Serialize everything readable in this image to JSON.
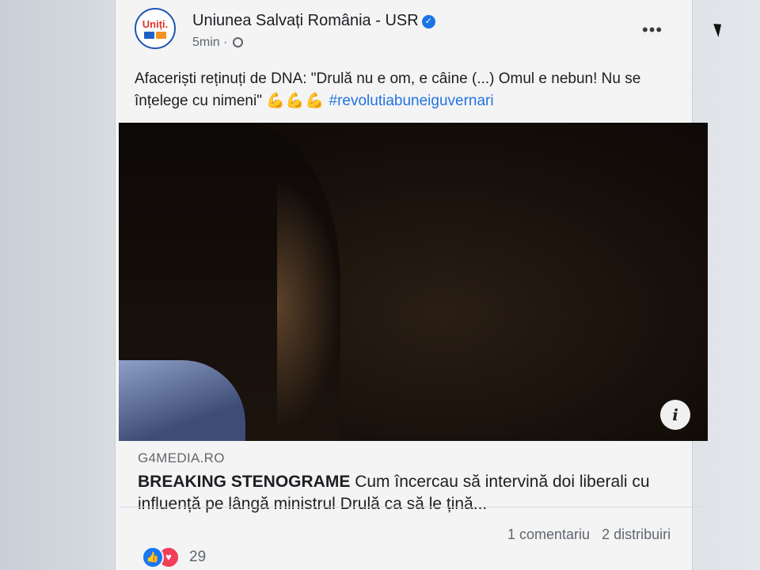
{
  "post": {
    "author": "Uniunea Salvați România - USR",
    "avatar_text": "Uniți.",
    "time": "5min",
    "text": "Afaceriști reținuți de DNA: \"Drulă nu e om, e câine (...) Omul e nebun! Nu se înțelege cu nimeni\"",
    "emoji": "💪💪💪",
    "hashtag": "#revolutiabuneiguvernari",
    "more_label": "•••",
    "info_label": "i"
  },
  "link": {
    "domain": "G4MEDIA.RO",
    "title_bold": "BREAKING STENOGRAME",
    "title_rest": " Cum încercau să intervină doi liberali cu influență pe lângă ministrul Drulă ca să le țină..."
  },
  "footer": {
    "reaction_count": "29",
    "comments": "1 comentariu",
    "shares": "2 distribuiri"
  },
  "icons": {
    "verified": "verified-badge-icon",
    "audience": "globe-icon",
    "like": "like-icon",
    "love": "love-icon"
  },
  "colors": {
    "accent": "#2374e1",
    "like": "#1877f2",
    "love": "#f33e58"
  }
}
